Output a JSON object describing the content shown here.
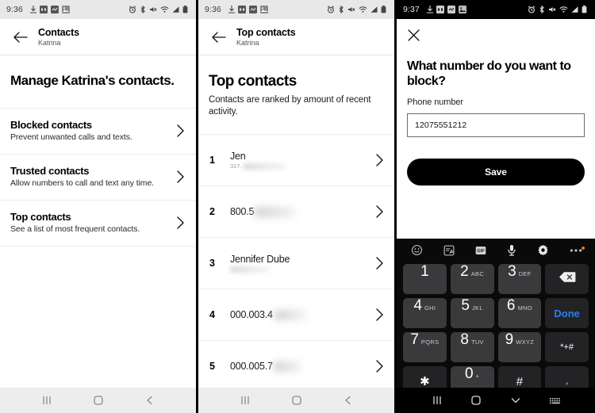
{
  "panels": [
    {
      "id": "contacts-settings",
      "status": {
        "time": "9:36",
        "icons_left": [
          "download-icon",
          "app-icon-1",
          "app-icon-2",
          "image-icon"
        ],
        "icons_right": [
          "alarm-icon",
          "bluetooth-icon",
          "mute-icon",
          "wifi-icon",
          "signal-icon",
          "battery-icon"
        ]
      },
      "appbar": {
        "back": "back-arrow",
        "title": "Contacts",
        "subtitle": "Katrina"
      },
      "hero": {
        "heading": "Manage Katrina's contacts."
      },
      "rows": [
        {
          "title": "Blocked contacts",
          "subtitle": "Prevent unwanted calls and texts."
        },
        {
          "title": "Trusted contacts",
          "subtitle": "Allow numbers to call and text any time."
        },
        {
          "title": "Top contacts",
          "subtitle": "See a list of most frequent contacts."
        }
      ],
      "nav": [
        "recents-button",
        "home-button",
        "back-button"
      ]
    },
    {
      "id": "top-contacts",
      "status": {
        "time": "9:36"
      },
      "appbar": {
        "title": "Top contacts",
        "subtitle": "Katrina"
      },
      "hero": {
        "heading": "Top contacts",
        "body": "Contacts are ranked by amount of recent activity."
      },
      "contacts": [
        {
          "rank": "1",
          "name": "Jen",
          "sub": "317.",
          "sub_redacted": true,
          "name_redacted": false
        },
        {
          "rank": "2",
          "name": "800.5",
          "sub": "",
          "name_redacted": true
        },
        {
          "rank": "3",
          "name": "Jennifer Dube",
          "sub": "",
          "sub_redacted": true
        },
        {
          "rank": "4",
          "name": "000.003.4",
          "sub": "",
          "name_redacted": true
        },
        {
          "rank": "5",
          "name": "000.005.7",
          "sub": "",
          "name_redacted": true
        }
      ],
      "nav": [
        "recents-button",
        "home-button",
        "back-button"
      ]
    },
    {
      "id": "block-number",
      "status": {
        "time": "9:37"
      },
      "dialog": {
        "close": "close-icon",
        "heading": "What number do you want to block?",
        "field_label": "Phone number",
        "field_value": "12075551212",
        "field_placeholder": "Phone number",
        "save_label": "Save"
      },
      "keyboard": {
        "tools": [
          "emoji-icon",
          "sticker-icon",
          "gif-icon",
          "microphone-icon",
          "settings-icon",
          "more-icon"
        ],
        "keys": [
          [
            {
              "num": "1",
              "let": ""
            },
            {
              "num": "2",
              "let": "ABC"
            },
            {
              "num": "3",
              "let": "DEF"
            },
            {
              "sym": "backspace-icon",
              "fn": true
            }
          ],
          [
            {
              "num": "4",
              "let": "GHI"
            },
            {
              "num": "5",
              "let": "JKL"
            },
            {
              "num": "6",
              "let": "MNO"
            },
            {
              "done": "Done",
              "fn": true
            }
          ],
          [
            {
              "num": "7",
              "let": "PQRS"
            },
            {
              "num": "8",
              "let": "TUV"
            },
            {
              "num": "9",
              "let": "WXYZ"
            },
            {
              "sym": "*+#",
              "fn": true
            }
          ],
          [
            {
              "sym": "✱",
              "fn": true
            },
            {
              "num": "0",
              "let": "+"
            },
            {
              "sym": "#",
              "fn": true
            },
            {
              "sym": ",",
              "fn": true
            }
          ]
        ]
      },
      "nav": [
        "recents-button",
        "home-button",
        "hide-keyboard-button",
        "keyboard-switch-button"
      ]
    }
  ],
  "colors": {
    "accent_blue": "#2a7ff0",
    "key_bg": "#3a3a3c",
    "key_fn_bg": "#232325",
    "keyboard_bg": "#0a0a0a",
    "badge_orange": "#f07422"
  }
}
